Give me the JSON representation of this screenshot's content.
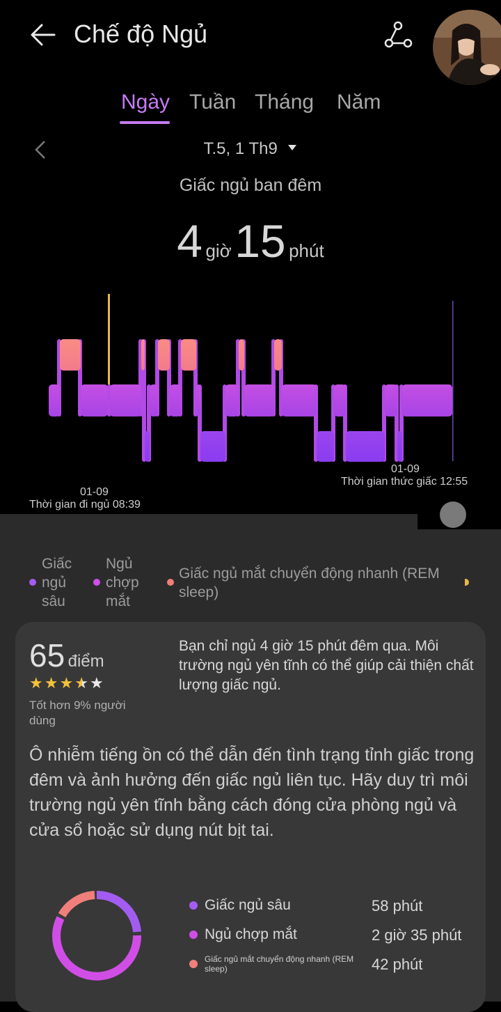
{
  "header": {
    "title": "Chế độ Ngủ"
  },
  "tabs": [
    {
      "label": "Ngày",
      "active": true
    },
    {
      "label": "Tuần",
      "active": false
    },
    {
      "label": "Tháng",
      "active": false
    },
    {
      "label": "Năm",
      "active": false
    }
  ],
  "date": {
    "label": "T.5, 1 Th9"
  },
  "summary": {
    "title": "Giấc ngủ ban đêm",
    "hours": "4",
    "hours_unit": "giờ",
    "minutes": "15",
    "minutes_unit": "phút"
  },
  "chart": {
    "sleep_date": "01-09",
    "sleep_time": "Thời gian đi ngủ 08:39",
    "wake_date": "01-09",
    "wake_time": "Thời gian thức giấc 12:55",
    "colors": {
      "deep": "#9b3ff0",
      "light": "#c74be0",
      "rem": "#f38a86",
      "awake": "#e8b64a"
    }
  },
  "legend": {
    "deep": "Giấc ngủ sâu",
    "light": "Ngủ chợp mắt",
    "rem": "Giấc ngủ mắt chuyển động nhanh (REM sleep)"
  },
  "score_card": {
    "score": "65",
    "score_unit": "điểm",
    "stars": 3.5,
    "comparison": "Tốt hơn 9% người dùng",
    "summary_text": "Bạn chỉ ngủ 4 giờ 15 phút đêm qua. Môi trường ngủ yên tĩnh có thể giúp cải thiện chất lượng giấc ngủ.",
    "advice": "Ô nhiễm tiếng ồn có thể dẫn đến tình trạng tỉnh giấc trong đêm và ảnh hưởng đến giấc ngủ liên tục. Hãy duy trì môi trường ngủ yên tĩnh bằng cách đóng cửa phòng ngủ và cửa sổ hoặc sử dụng nút bịt tai."
  },
  "stats": [
    {
      "label": "Giấc ngủ sâu",
      "value": "58 phút",
      "color": "#a35cf0"
    },
    {
      "label": "Ngủ chợp mắt",
      "value": "2 giờ 35 phút",
      "color": "#d04ee6"
    },
    {
      "label": "Giấc ngủ mắt chuyển động nhanh (REM sleep)",
      "value": "42 phút",
      "color": "#f07f7c"
    }
  ]
}
